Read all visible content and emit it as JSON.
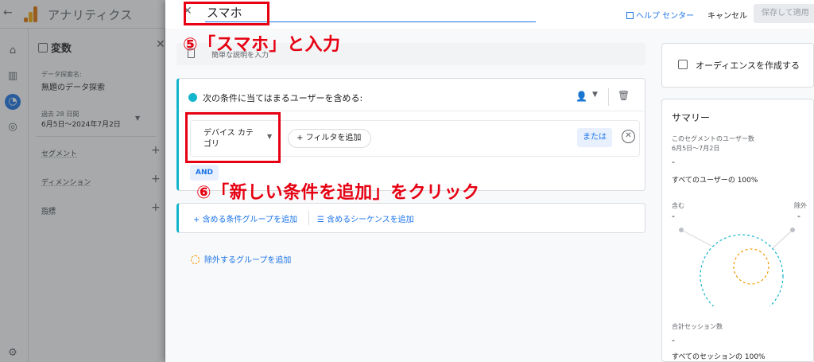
{
  "app": {
    "title": "アナリティクス"
  },
  "variables_panel": {
    "title": "変数",
    "exploration_name_label": "データ探索名:",
    "exploration_name": "無題のデータ探索",
    "date_range_label": "過去 28 日間",
    "date_range": "6月5日～2024年7月2日",
    "sections": [
      "セグメント",
      "ディメンション",
      "指標"
    ]
  },
  "dialog": {
    "segment_name": "スマホ",
    "help_label": "ヘルプ センター",
    "cancel_label": "キャンセル",
    "save_label": "保存して適用",
    "description_placeholder": "簡単な説明を入力",
    "condition_title": "次の条件に当てはまるユーザーを含める:",
    "dimension_select": "デバイス カテゴリ",
    "add_filter_label": "フィルタを追加",
    "or_label": "または",
    "and_label": "AND",
    "add_condition_group": "含める条件グループを追加",
    "add_sequence": "含めるシーケンスを追加",
    "add_exclude_group": "除外するグループを追加"
  },
  "side": {
    "create_audience": "オーディエンスを作成する",
    "summary_title": "サマリー",
    "segment_users_label": "このセグメントのユーザー数",
    "segment_users_dates": "6月5日～7月2日",
    "dash": "-",
    "all_users_pct": "すべてのユーザーの 100%",
    "include_label": "含む",
    "exclude_label": "除外",
    "total_sessions_label": "合計セッション数",
    "all_sessions_pct": "すべてのセッションの 100%"
  },
  "annotations": {
    "step5": "⑤「スマホ」と入力",
    "step6": "⑥「新しい条件を追加」をクリック",
    "color": "#e60012"
  }
}
